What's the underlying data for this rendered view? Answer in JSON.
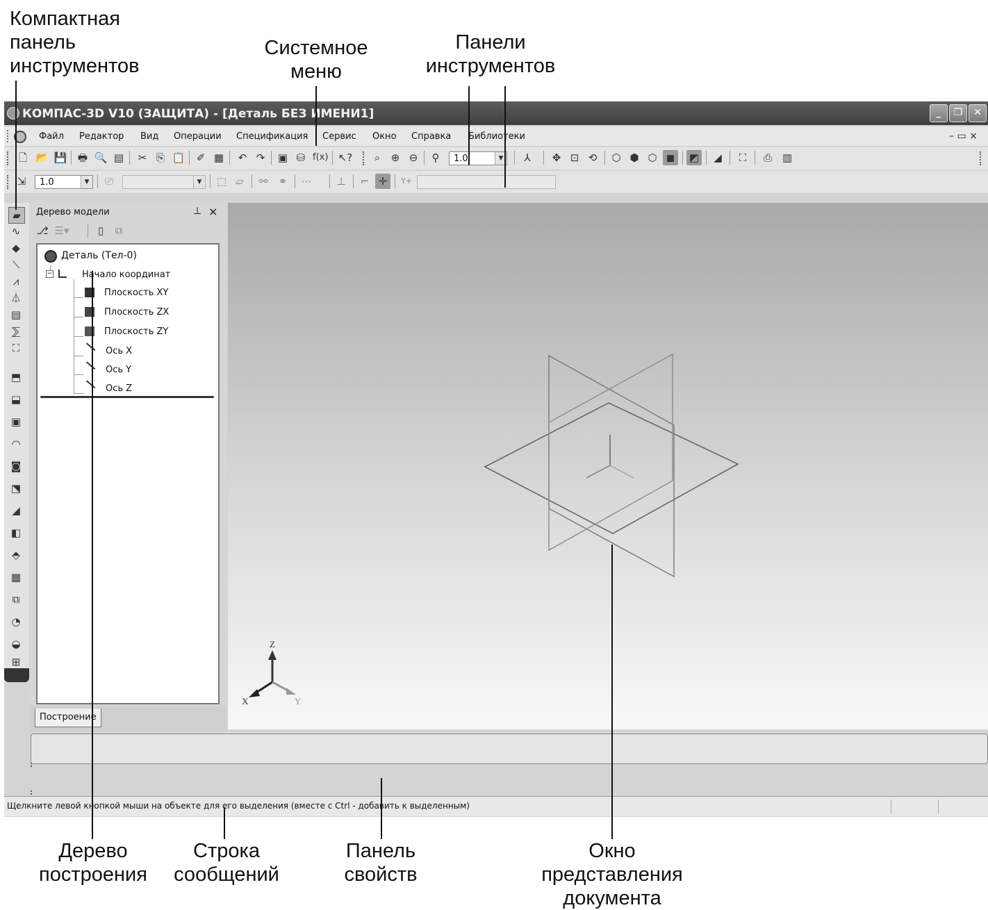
{
  "callouts": {
    "compact_panel": [
      "Компактная",
      "панель",
      "инструментов"
    ],
    "system_menu": [
      "Системное",
      "меню"
    ],
    "toolbars": [
      "Панели",
      "инструментов"
    ],
    "build_tree": [
      "Дерево",
      "построения"
    ],
    "message_line": [
      "Строка",
      "сообщений"
    ],
    "properties_panel": [
      "Панель",
      "свойств"
    ],
    "document_window": [
      "Окно",
      "представления",
      "документа"
    ]
  },
  "window": {
    "title": "КОМПАС-3D V10 (ЗАЩИТА) - [Деталь БЕЗ ИМЕНИ1]",
    "controls": {
      "minimize": "_",
      "maximize": "❐",
      "close": "✕"
    }
  },
  "menu": {
    "items": [
      "Файл",
      "Редактор",
      "Вид",
      "Операции",
      "Спецификация",
      "Сервис",
      "Окно",
      "Справка",
      "Библиотеки"
    ],
    "mdi_controls": "– ▭ ×"
  },
  "toolbar": {
    "zoom_value": "1.0",
    "step_value": "1.0"
  },
  "tree_panel": {
    "title": "Дерево модели",
    "pin": "ᵖ",
    "close": "×",
    "nodes": [
      "Деталь (Тел-0)",
      "Начало координат",
      "Плоскость XY",
      "Плоскость ZX",
      "Плоскость ZY",
      "Ось X",
      "Ось Y",
      "Ось Z"
    ],
    "tab": "Построение"
  },
  "viewport": {
    "axis_labels": {
      "x": "X",
      "y": "Y",
      "z": "Z"
    }
  },
  "status": {
    "message": "Щелкните левой кнопкой мыши на объекте для его выделения (вместе с Ctrl - добавить к выделенным)"
  }
}
